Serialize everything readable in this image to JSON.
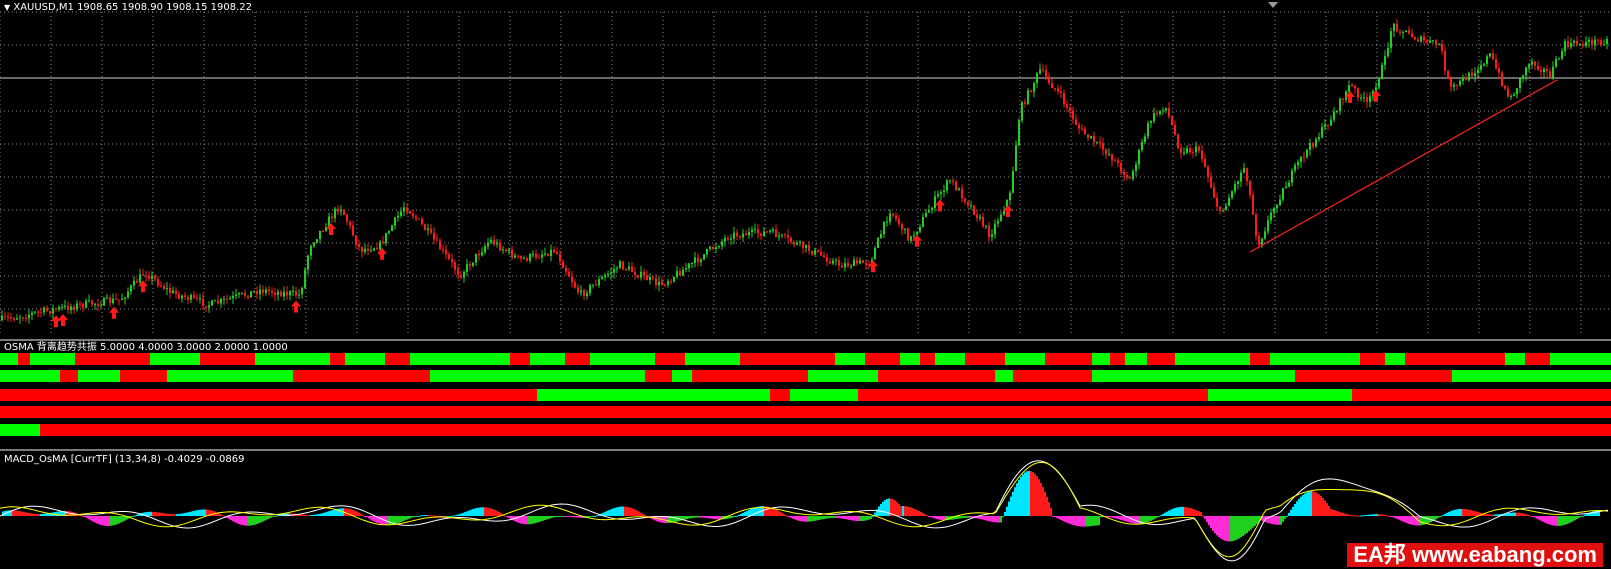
{
  "main_chart": {
    "title": "XAUUSD,M1  1908.65 1908.90 1908.15 1908.22",
    "symbol_icon": "collapse-triangle-icon",
    "colors": {
      "bull": "#1fd01f",
      "bear": "#ff1a1a",
      "grid": "#8a8a8a",
      "trendline": "#ff2020",
      "level_line": "#d0d0d0"
    }
  },
  "osma_panel": {
    "title": "OSMA 背离趋势共振 5.0000 4.0000 3.0000 2.0000 1.0000",
    "colors": {
      "up": "#00ff00",
      "down": "#ff0000"
    }
  },
  "macd_panel": {
    "title": "MACD_OsMA [CurrTF] (13,34,8) -0.4029 -0.0869",
    "colors": {
      "pos_up": "#00e5ff",
      "pos_down": "#ff1a1a",
      "neg_up": "#1fd01f",
      "neg_down": "#ff2bd6",
      "main_line": "#ffffff",
      "signal_line": "#ffff00"
    }
  },
  "watermark": {
    "text": "EA邦 www.eabang.com",
    "color": "#e01010"
  }
}
